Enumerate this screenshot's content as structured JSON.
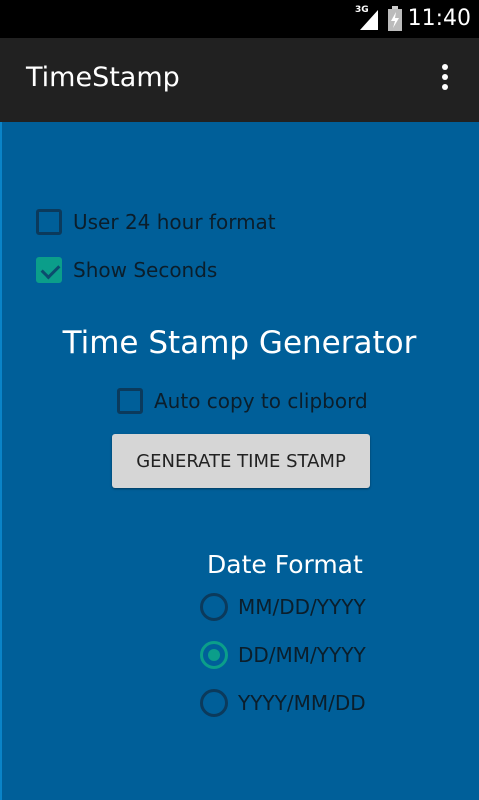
{
  "status_bar": {
    "network": "3G",
    "time": "11:40"
  },
  "app": {
    "title": "TimeStamp"
  },
  "options": {
    "use_24_label": "User 24 hour format",
    "use_24_checked": false,
    "show_seconds_label": "Show Seconds",
    "show_seconds_checked": true
  },
  "generator": {
    "heading": "Time Stamp Generator",
    "auto_copy_label": "Auto copy to clipbord",
    "auto_copy_checked": false,
    "button_label": "GENERATE TIME STAMP"
  },
  "date_format": {
    "title": "Date Format",
    "options": [
      {
        "label": "MM/DD/YYYY",
        "selected": false
      },
      {
        "label": "DD/MM/YYYY",
        "selected": true
      },
      {
        "label": "YYYY/MM/DD",
        "selected": false
      }
    ]
  },
  "colors": {
    "background": "#005f99",
    "action_bar": "#212121",
    "accent": "#0b9e8a"
  },
  "icons": [
    "signal-icon",
    "battery-icon",
    "overflow-menu-icon",
    "checkbox-icon",
    "radio-icon"
  ]
}
